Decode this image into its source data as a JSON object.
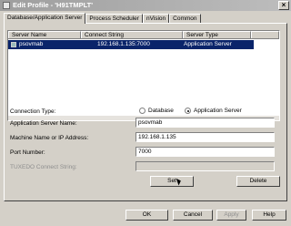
{
  "window": {
    "title": "Edit Profile - 'H91TMPLT'"
  },
  "tabs": [
    {
      "label": "Database/Application Server"
    },
    {
      "label": "Process Scheduler"
    },
    {
      "label": "nVision"
    },
    {
      "label": "Common"
    }
  ],
  "list": {
    "headers": [
      "Server Name",
      "Connect String",
      "Server Type",
      ""
    ],
    "rows": [
      {
        "name": "psovmab",
        "connect": "192.168.1.135:7000",
        "type": "Application Server"
      }
    ]
  },
  "form": {
    "connection_type_label": "Connection Type:",
    "radio_database": "Database",
    "radio_app_server": "Application Server",
    "app_server_name_label": "Application Server Name:",
    "app_server_name_value": "psovmab",
    "machine_label": "Machine Name or IP Address:",
    "machine_value": "192.168.1.135",
    "port_label": "Port Number:",
    "port_value": "7000",
    "tuxedo_label": "TUXEDO Connect String:",
    "tuxedo_value": ""
  },
  "buttons": {
    "set": "Set",
    "delete": "Delete",
    "ok": "OK",
    "cancel": "Cancel",
    "apply": "Apply",
    "help": "Help"
  }
}
